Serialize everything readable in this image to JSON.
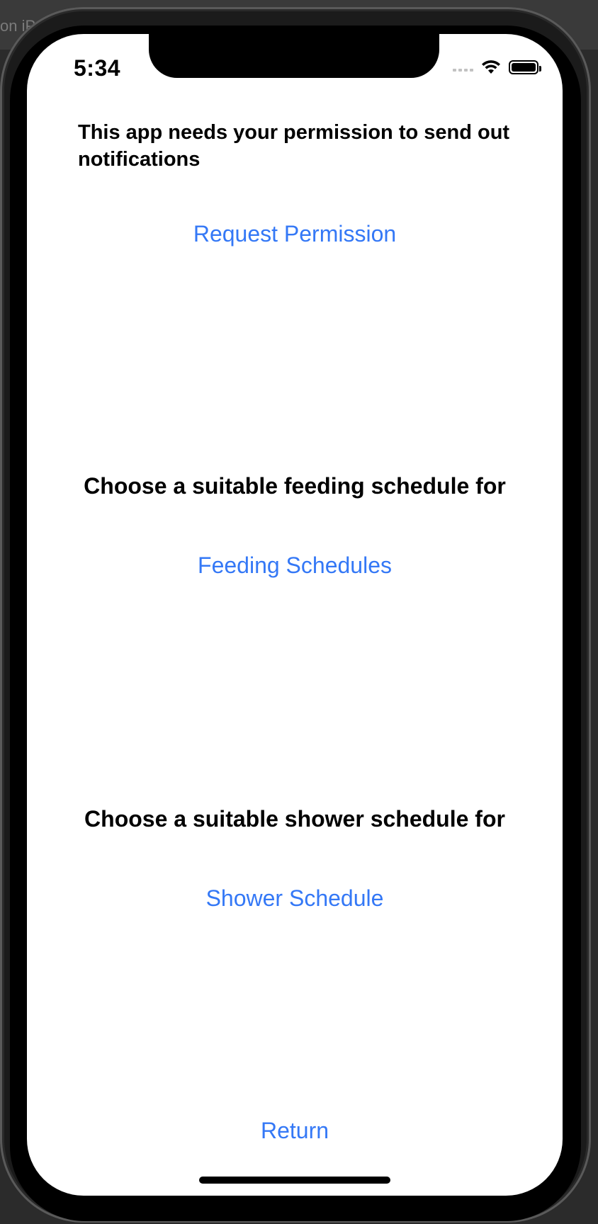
{
  "host": {
    "partial_title": "on iP"
  },
  "status_bar": {
    "time": "5:34",
    "signal_icon": "cellular-signal-icon",
    "wifi_icon": "wifi-icon",
    "battery_icon": "battery-icon"
  },
  "permission": {
    "message": "This app needs your permission to send out notifications",
    "button_label": "Request Permission"
  },
  "feeding": {
    "prompt": "Choose a suitable feeding schedule for",
    "button_label": "Feeding Schedules"
  },
  "shower": {
    "prompt": "Choose a suitable shower schedule for",
    "button_label": "Shower Schedule"
  },
  "footer": {
    "return_label": "Return"
  },
  "colors": {
    "link": "#3478f6",
    "background": "#ffffff",
    "text": "#000000"
  }
}
